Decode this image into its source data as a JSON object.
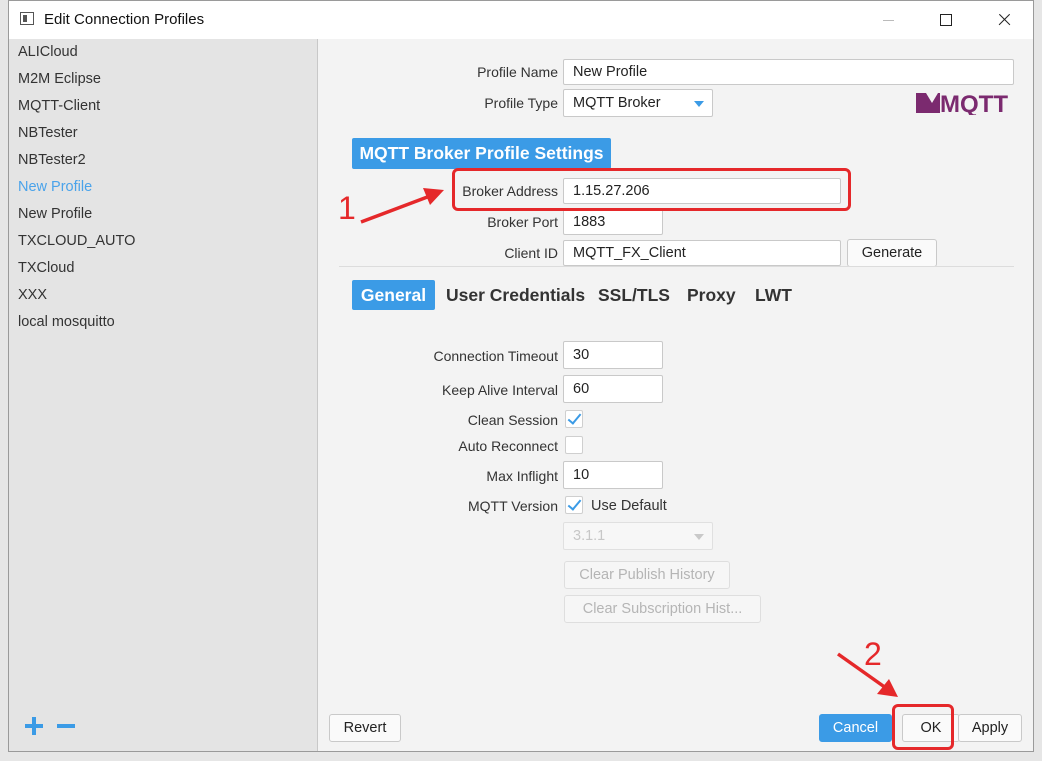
{
  "window": {
    "title": "Edit Connection Profiles"
  },
  "sidebar": {
    "profiles": [
      {
        "label": "ALICloud"
      },
      {
        "label": "M2M Eclipse"
      },
      {
        "label": "MQTT-Client"
      },
      {
        "label": "NBTester"
      },
      {
        "label": "NBTester2"
      },
      {
        "label": "New Profile",
        "selected": true
      },
      {
        "label": "New Profile"
      },
      {
        "label": "TXCLOUD_AUTO"
      },
      {
        "label": "TXCloud"
      },
      {
        "label": "XXX"
      },
      {
        "label": "local mosquitto"
      }
    ],
    "add_icon": "plus-icon",
    "remove_icon": "minus-icon"
  },
  "form": {
    "profile_name_label": "Profile Name",
    "profile_name_value": "New Profile",
    "profile_type_label": "Profile Type",
    "profile_type_value": "MQTT Broker",
    "section_title": "MQTT Broker Profile Settings",
    "broker_address_label": "Broker Address",
    "broker_address_value": "1.15.27.206",
    "broker_port_label": "Broker Port",
    "broker_port_value": "1883",
    "client_id_label": "Client ID",
    "client_id_value": "MQTT_FX_Client",
    "generate_label": "Generate",
    "logo_text": "MQTT"
  },
  "tabs": [
    {
      "label": "General",
      "active": true
    },
    {
      "label": "User Credentials"
    },
    {
      "label": "SSL/TLS"
    },
    {
      "label": "Proxy"
    },
    {
      "label": "LWT"
    }
  ],
  "general": {
    "connection_timeout_label": "Connection Timeout",
    "connection_timeout_value": "30",
    "keep_alive_label": "Keep Alive Interval",
    "keep_alive_value": "60",
    "clean_session_label": "Clean Session",
    "clean_session_checked": true,
    "auto_reconnect_label": "Auto Reconnect",
    "auto_reconnect_checked": false,
    "max_inflight_label": "Max Inflight",
    "max_inflight_value": "10",
    "mqtt_version_label": "MQTT Version",
    "use_default_label": "Use Default",
    "use_default_checked": true,
    "mqtt_version_value": "3.1.1",
    "clear_publish_label": "Clear Publish History",
    "clear_subscription_label": "Clear Subscription Hist..."
  },
  "footer": {
    "revert_label": "Revert",
    "cancel_label": "Cancel",
    "ok_label": "OK",
    "apply_label": "Apply"
  },
  "annotations": {
    "step1": "1",
    "step2": "2",
    "color": "#e5282a"
  },
  "colors": {
    "accent": "#3b9be6",
    "selected_text": "#4aa3ea"
  }
}
